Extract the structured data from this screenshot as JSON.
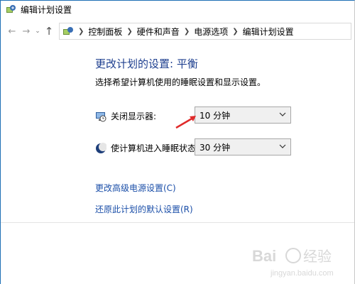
{
  "window": {
    "title": "编辑计划设置"
  },
  "nav": {
    "back_icon": "arrow-left-icon",
    "forward_icon": "arrow-right-icon",
    "recent_icon": "chevron-down-icon",
    "up_icon": "arrow-up-icon"
  },
  "breadcrumbs": [
    "控制面板",
    "硬件和声音",
    "电源选项",
    "编辑计划设置"
  ],
  "page": {
    "heading": "更改计划的设置: 平衡",
    "subtitle": "选择希望计算机使用的睡眠设置和显示设置。"
  },
  "settings": {
    "display_off": {
      "label": "关闭显示器:",
      "value": "10 分钟",
      "icon": "monitor-clock-icon"
    },
    "sleep": {
      "label": "使计算机进入睡眠状态:",
      "value": "30 分钟",
      "icon": "moon-icon"
    }
  },
  "links": {
    "advanced": "更改高级电源设置(C)",
    "restore": "还原此计划的默认设置(R)"
  },
  "watermark": {
    "logo": "Baidu经验",
    "url": "jingyan.baidu.com"
  },
  "colors": {
    "heading": "#1e3f8f",
    "link": "#1a4ea8",
    "annotation_arrow": "#e02a2a"
  }
}
